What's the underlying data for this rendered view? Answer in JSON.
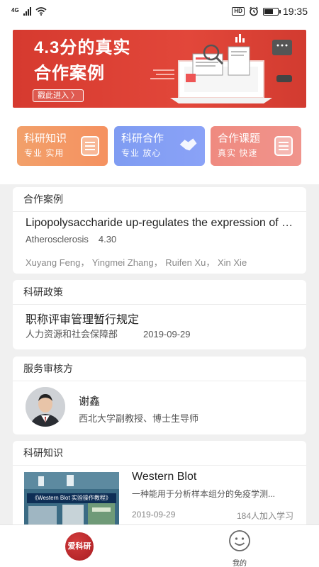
{
  "status_bar": {
    "network": "4G",
    "hd_badge": "HD",
    "time": "19:35",
    "battery_level": 0.7,
    "icons": [
      "signal-icon",
      "wifi-icon",
      "hd-icon",
      "alarm-icon",
      "battery-icon"
    ]
  },
  "banner": {
    "line1": "4.3分的真实",
    "line2": "合作案例",
    "cta": "戳此进入 〉"
  },
  "quick_links": [
    {
      "title": "科研知识",
      "subtitle": "专业  实用",
      "icon": "document-icon"
    },
    {
      "title": "科研合作",
      "subtitle": "专业  放心",
      "icon": "handshake-icon"
    },
    {
      "title": "合作课题",
      "subtitle": "真实  快速",
      "icon": "document-icon"
    }
  ],
  "cases": {
    "heading": "合作案例",
    "title": "Lipopolysaccharide up-regulates the expression of F...",
    "journal": "Atherosclerosis",
    "impact": "4.30",
    "authors": "Xuyang Feng，  Yingmei Zhang，  Ruifen Xu，  Xin Xie"
  },
  "policy": {
    "heading": "科研政策",
    "title": "职称评审管理暂行规定",
    "source": "人力资源和社会保障部",
    "date": "2019-09-29"
  },
  "reviewer": {
    "heading": "服务审核方",
    "name": "谢鑫",
    "description": "西北大学副教授、博士生导师"
  },
  "knowledge": {
    "heading": "科研知识",
    "thumb_caption": "《Western Blot 实验操作教程》",
    "title": "Western Blot",
    "subtitle": "一种能用于分析样本组分的免疫学测...",
    "date": "2019-09-29",
    "learners": "184人加入学习"
  },
  "tabbar": {
    "home_logo": "爱科研",
    "me_label": "我的"
  },
  "colors": {
    "banner_red": "#d63a2f",
    "quick1": "#f59160",
    "quick2": "#8aa2f7",
    "quick3": "#f0948c"
  }
}
